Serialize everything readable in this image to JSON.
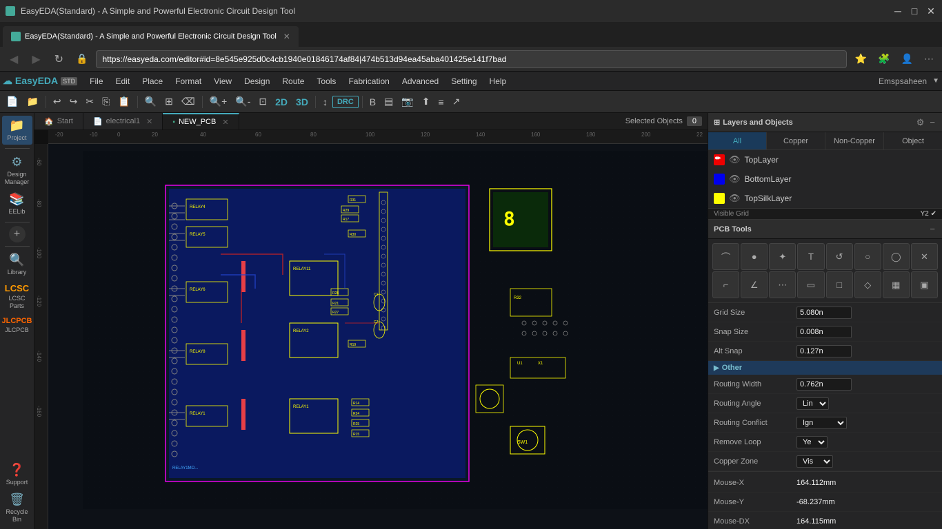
{
  "browser": {
    "title": "EasyEDA(Standard) - A Simple and Powerful Electronic Circuit Design Tool",
    "url": "https://easyeda.com/editor#id=8e545e925d0c4cb1940e01846174af84|474b513d94ea45aba401425e141f7bad",
    "tab_label": "EasyEDA(Standard) - A Simple and Powerful Electronic Circuit Design Tool"
  },
  "app": {
    "logo": "EasyEDA",
    "badge": "STD",
    "menus": [
      "File",
      "Edit",
      "Place",
      "Format",
      "View",
      "Design",
      "Route",
      "Tools",
      "Fabrication",
      "Advanced",
      "Setting",
      "Help"
    ],
    "user": "Emspsaheen"
  },
  "tabs": [
    {
      "label": "Start",
      "icon": "🏠",
      "active": false
    },
    {
      "label": "electrical1",
      "icon": "📄",
      "active": false
    },
    {
      "label": "NEW_PCB",
      "icon": "🟩",
      "active": true
    }
  ],
  "selected_objects_label": "Selected Objects",
  "selected_objects_count": "0",
  "layers_panel": {
    "title": "Layers and Objects",
    "filters": [
      "All",
      "Copper",
      "Non-Copper",
      "Object"
    ],
    "active_filter": "All",
    "layers": [
      {
        "name": "TopLayer",
        "color": "#e00",
        "visible": true
      },
      {
        "name": "BottomLayer",
        "color": "#00e",
        "visible": true
      },
      {
        "name": "TopSilkLayer",
        "color": "#ff0",
        "visible": true
      }
    ]
  },
  "pcb_tools": {
    "title": "PCB Tools",
    "tools": [
      "⌒",
      "●",
      "✦",
      "T",
      "↺",
      "○",
      "◯",
      "✕",
      "⌐",
      "∠",
      "◈",
      "▭",
      "□",
      "◇",
      "▦",
      "▣"
    ]
  },
  "properties": {
    "grid_size_label": "Grid Size",
    "grid_size_value": "5.080n",
    "snap_size_label": "Snap Size",
    "snap_size_value": "0.008n",
    "alt_snap_label": "Alt Snap",
    "alt_snap_value": "0.127n",
    "section_other": "Other",
    "routing_width_label": "Routing Width",
    "routing_width_value": "0.762n",
    "routing_angle_label": "Routing Angle",
    "routing_angle_value": "Lin",
    "routing_conflict_label": "Routing Conflict",
    "routing_conflict_value": "Ign",
    "remove_loop_label": "Remove Loop",
    "remove_loop_value": "Ye",
    "copper_zone_label": "Copper Zone",
    "copper_zone_value": "Vis",
    "mouse_x_label": "Mouse-X",
    "mouse_x_value": "164.112mm",
    "mouse_y_label": "Mouse-Y",
    "mouse_y_value": "-68.237mm",
    "mouse_dx_label": "Mouse-DX",
    "mouse_dx_value": "164.115mm"
  },
  "sidebar_icons": [
    {
      "symbol": "📁",
      "label": "Project"
    },
    {
      "symbol": "⚙",
      "label": "Design\nManager"
    },
    {
      "symbol": "📚",
      "label": "EELib"
    },
    {
      "symbol": "🔍",
      "label": "Library"
    },
    {
      "symbol": "🔧",
      "label": "LCSC\nParts"
    },
    {
      "symbol": "🏭",
      "label": "JLCPCB"
    },
    {
      "symbol": "❓",
      "label": "Support"
    },
    {
      "symbol": "🗑",
      "label": "Recycle\nBin"
    }
  ],
  "ruler": {
    "h_ticks": [
      "-20",
      "-10",
      "0",
      "20",
      "40",
      "60",
      "80",
      "100",
      "120",
      "140",
      "160",
      "180",
      "200",
      "22"
    ],
    "v_ticks": [
      "-60",
      "-80",
      "-100",
      "-120",
      "-140",
      "-160"
    ]
  }
}
